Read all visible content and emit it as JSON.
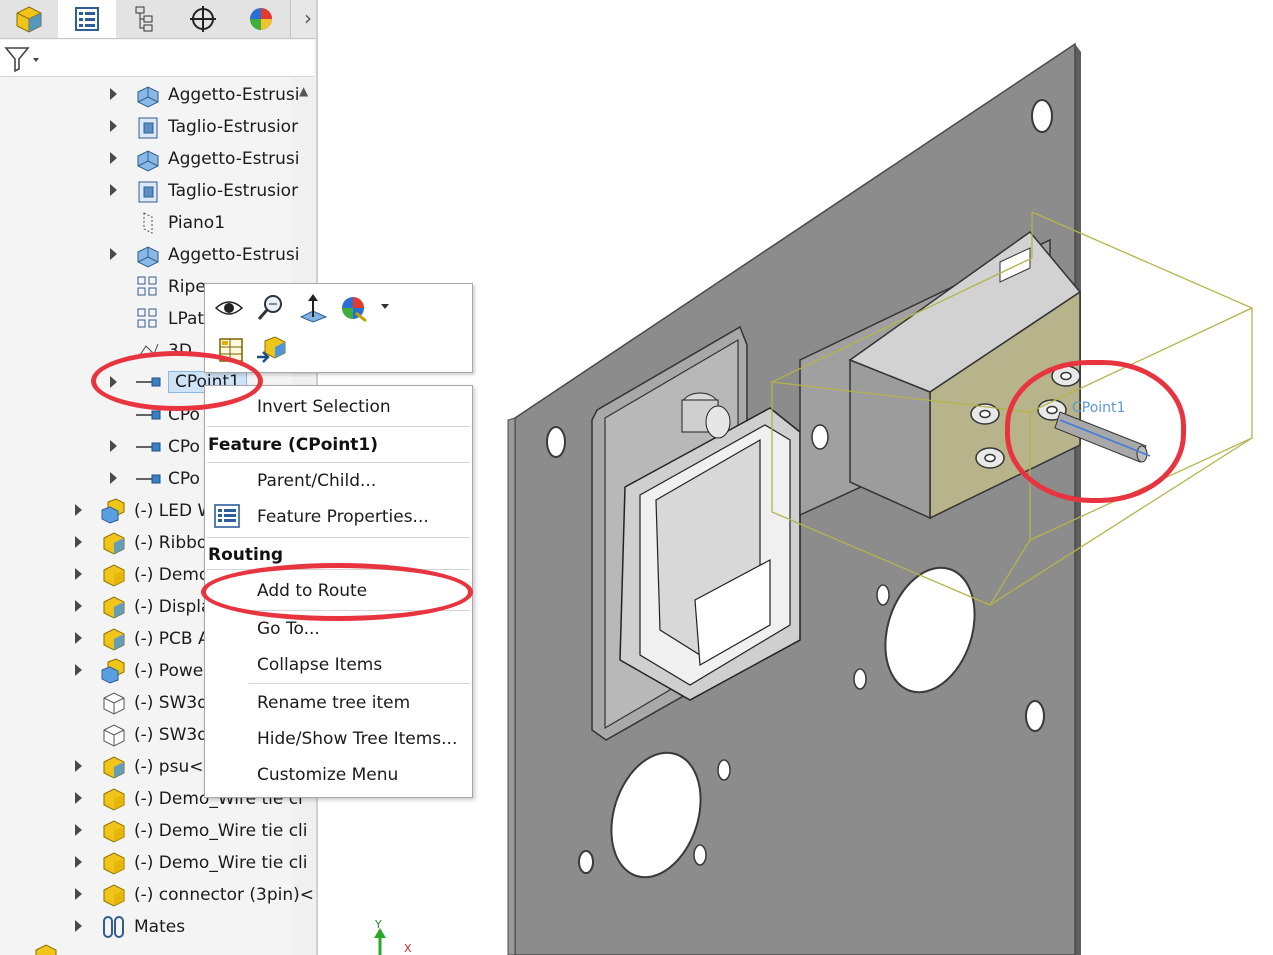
{
  "tree": {
    "rows": [
      {
        "label": "Aggetto-Estrusi",
        "icon": "extrude-boss-icon"
      },
      {
        "label": "Taglio-Estrusior",
        "icon": "extrude-cut-icon"
      },
      {
        "label": "Aggetto-Estrusi",
        "icon": "extrude-boss-icon"
      },
      {
        "label": "Taglio-Estrusior",
        "icon": "extrude-cut-icon"
      },
      {
        "label": "Piano1",
        "icon": "plane-icon"
      },
      {
        "label": "Aggetto-Estrusi",
        "icon": "extrude-boss-icon"
      },
      {
        "label": "Ripe",
        "icon": "pattern-icon"
      },
      {
        "label": "LPat",
        "icon": "pattern-icon"
      },
      {
        "label": "3D",
        "icon": "sketch-3d-icon"
      },
      {
        "label": "CPoint1",
        "icon": "connection-point-icon"
      },
      {
        "label": "CPo",
        "icon": "connection-point-icon"
      },
      {
        "label": "CPo",
        "icon": "connection-point-icon"
      },
      {
        "label": "CPo",
        "icon": "connection-point-icon"
      },
      {
        "label": "(-) LED W",
        "icon": "assembly-icon"
      },
      {
        "label": "(-) Ribbo",
        "icon": "part-icon"
      },
      {
        "label": "(-) Demo",
        "icon": "part-icon"
      },
      {
        "label": "(-) Displa",
        "icon": "part-icon"
      },
      {
        "label": "(-) PCB A",
        "icon": "part-icon"
      },
      {
        "label": "(-) Power",
        "icon": "assembly-icon"
      },
      {
        "label": "(-) SW3d",
        "icon": "part-outline-icon"
      },
      {
        "label": "(-) SW3d",
        "icon": "part-outline-icon"
      },
      {
        "label": "(-) psu<1",
        "icon": "part-icon"
      },
      {
        "label": "(-) Demo_Wire tie cl",
        "icon": "part-icon"
      },
      {
        "label": "(-) Demo_Wire tie cli",
        "icon": "part-icon"
      },
      {
        "label": "(-) Demo_Wire tie cli",
        "icon": "part-icon"
      },
      {
        "label": "(-) connector (3pin)<",
        "icon": "part-icon"
      },
      {
        "label": "Mates",
        "icon": "mates-icon"
      }
    ]
  },
  "context_menu": {
    "invert_selection": "Invert Selection",
    "feature_header": "Feature (CPoint1)",
    "parent_child": "Parent/Child...",
    "feature_properties": "Feature Properties...",
    "routing_header": "Routing",
    "add_to_route": "Add to Route",
    "go_to": "Go To...",
    "collapse_items": "Collapse Items",
    "rename_tree_item": "Rename tree item",
    "hide_show_tree_items": "Hide/Show Tree Items...",
    "customize_menu": "Customize Menu"
  },
  "viewport": {
    "cpoint_label": "CPoint1"
  },
  "colors": {
    "annotation_ring": "#e8343f",
    "selection": "#cfe3f7",
    "model_gray": "#8c8c8c"
  }
}
